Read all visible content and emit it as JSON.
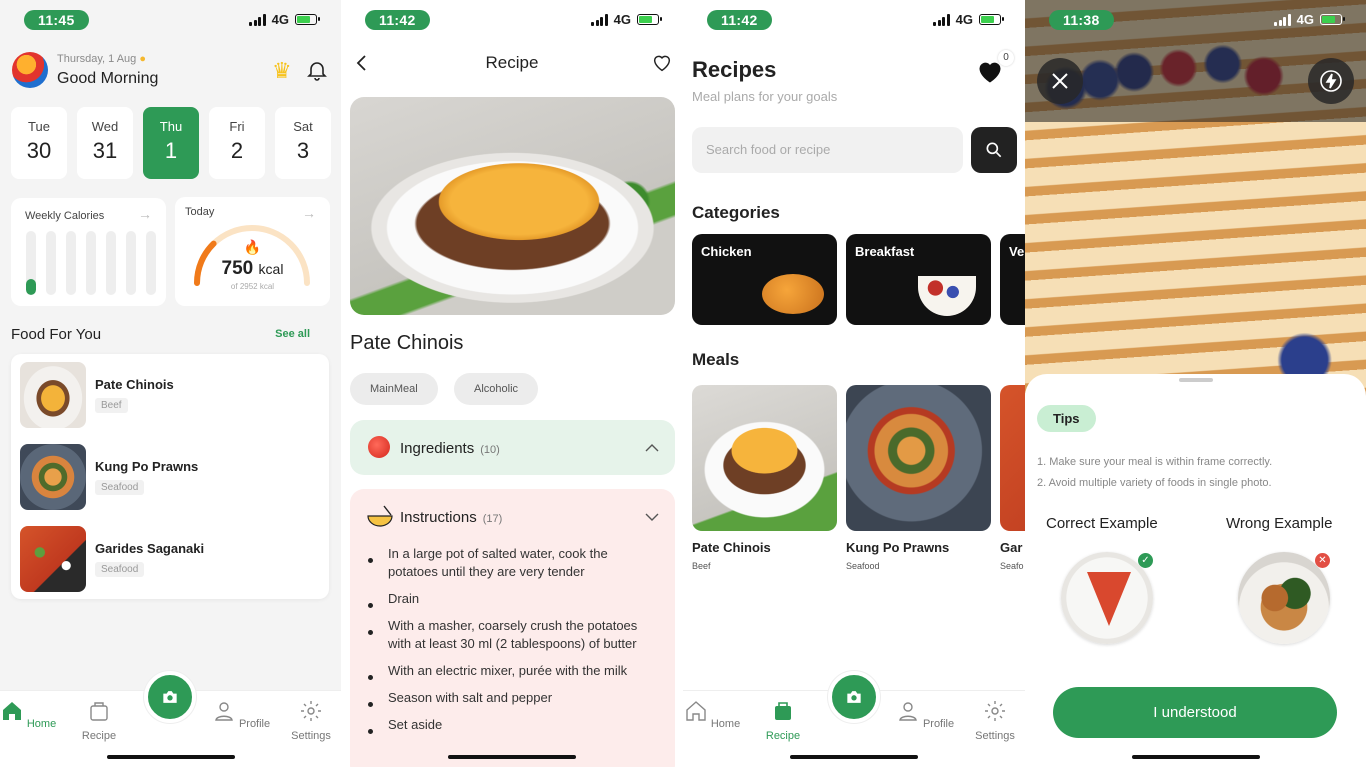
{
  "colors": {
    "brand_green": "#2e9a56",
    "light_green": "#c9eed3",
    "ingredients_bg": "#e6f3ea",
    "instructions_bg": "#fdeceb"
  },
  "screen_home": {
    "status": {
      "time": "11:45",
      "network": "4G"
    },
    "greeting_date": "Thursday, 1 Aug",
    "greeting": "Good Morning",
    "days": [
      {
        "name": "Tue",
        "date": "30"
      },
      {
        "name": "Wed",
        "date": "31"
      },
      {
        "name": "Thu",
        "date": "1",
        "active": true
      },
      {
        "name": "Fri",
        "date": "2"
      },
      {
        "name": "Sat",
        "date": "3"
      }
    ],
    "weekly_calories": {
      "title": "Weekly Calories",
      "levels": [
        0.25,
        0,
        0,
        0,
        0,
        0,
        0
      ]
    },
    "today": {
      "title": "Today",
      "value": "750",
      "unit": "kcal",
      "of_text": "of 2952 kcal",
      "progress": 0.254
    },
    "food_section_title": "Food For You",
    "see_all": "See all",
    "foods": [
      {
        "name": "Pate Chinois",
        "tag": "Beef"
      },
      {
        "name": "Kung Po Prawns",
        "tag": "Seafood"
      },
      {
        "name": "Garides Saganaki",
        "tag": "Seafood"
      }
    ]
  },
  "screen_recipe": {
    "status": {
      "time": "11:42",
      "network": "4G"
    },
    "title": "Recipe",
    "recipe_name": "Pate Chinois",
    "chips": [
      "MainMeal",
      "Alcoholic"
    ],
    "ingredients": {
      "label": "Ingredients",
      "count": "(10)"
    },
    "instructions": {
      "label": "Instructions",
      "count": "(17)"
    },
    "steps": [
      "In a large pot of salted water, cook the potatoes until they are very tender",
      "Drain",
      "With a masher, coarsely crush the potatoes with at least 30 ml (2 tablespoons) of butter",
      "With an electric mixer, purée with the milk",
      "Season with salt and pepper",
      "Set aside"
    ]
  },
  "screen_recipes": {
    "status": {
      "time": "11:42",
      "network": "4G"
    },
    "title": "Recipes",
    "subtitle": "Meal plans for your goals",
    "favorites_count": "0",
    "search_placeholder": "Search food or recipe",
    "categories_title": "Categories",
    "categories": [
      "Chicken",
      "Breakfast",
      "Ve"
    ],
    "meals_title": "Meals",
    "meals": [
      {
        "name": "Pate Chinois",
        "tag": "Beef"
      },
      {
        "name": "Kung Po Prawns",
        "tag": "Seafood"
      },
      {
        "name": "Gar",
        "tag": "Seafo"
      }
    ]
  },
  "screen_camera": {
    "status": {
      "time": "11:38",
      "network": "4G"
    },
    "tips_label": "Tips",
    "tips": [
      "1. Make sure your meal is within frame correctly.",
      "2. Avoid multiple variety of foods in single photo."
    ],
    "correct_label": "Correct Example",
    "wrong_label": "Wrong Example",
    "button_label": "I understood"
  },
  "nav": {
    "home": "Home",
    "recipe": "Recipe",
    "profile": "Profile",
    "settings": "Settings"
  }
}
